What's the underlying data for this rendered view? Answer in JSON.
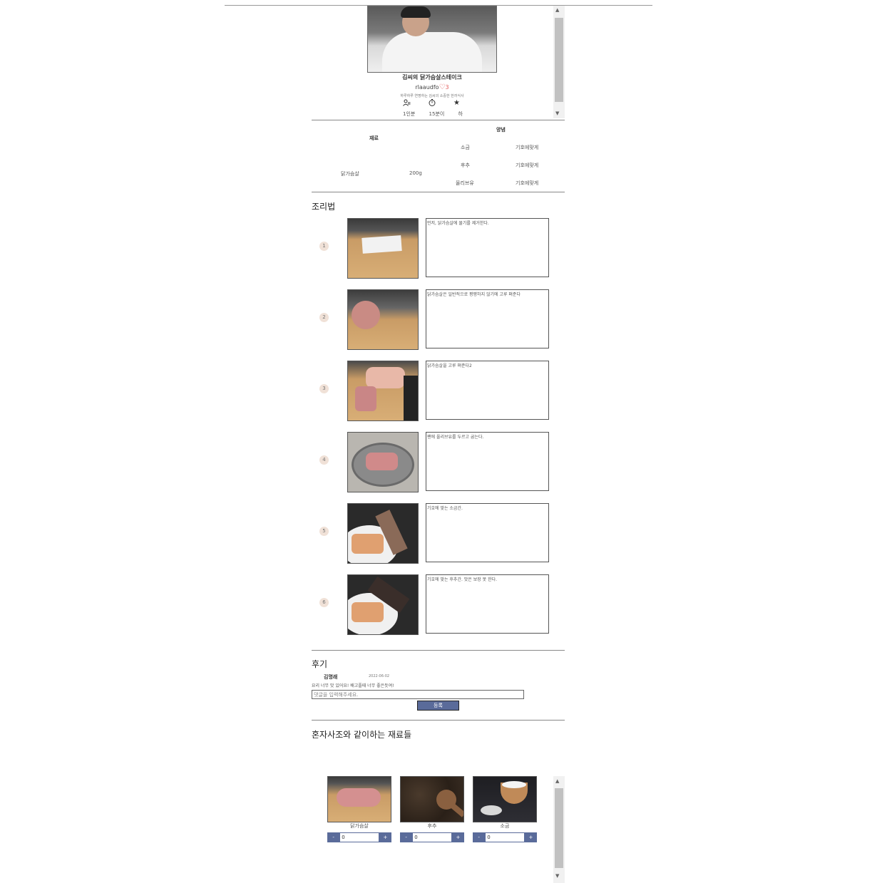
{
  "recipe": {
    "title": "김씨의 닭가슴살스테이크",
    "author": "rlaaudfo",
    "heart_icon": "♡",
    "likes": "3",
    "subtitle": "하루하루 연명하는 김씨의 소중한 한끼식사",
    "icons": {
      "servings": "servings-icon",
      "time": "timer-icon",
      "difficulty": "star-icon"
    },
    "servings": "1인분",
    "time": "15분이",
    "difficulty": "하"
  },
  "ingredients": {
    "header": "재료",
    "items": [
      {
        "name": "닭가슴살",
        "amount": "200g"
      }
    ]
  },
  "seasoning": {
    "header": "양념",
    "items": [
      {
        "name": "소금",
        "amount": "기호에맞게"
      },
      {
        "name": "후추",
        "amount": "기호에맞게"
      },
      {
        "name": "올리브유",
        "amount": "기호에맞게"
      }
    ]
  },
  "steps_title": "조리법",
  "steps": [
    {
      "num": "1",
      "text": "먼저, 닭가슴살에 물기를 제거한다."
    },
    {
      "num": "2",
      "text": "닭가슴살은 일반적으로 평평하지 않기에 고루 펴준다"
    },
    {
      "num": "3",
      "text": "닭가슴살을 고루 펴준다2"
    },
    {
      "num": "4",
      "text": "팬에 올리브유를 두르고 굽는다."
    },
    {
      "num": "5",
      "text": "기호에 맞는 소금간."
    },
    {
      "num": "6",
      "text": "기호에 맞는 후추간. 맛은 보장 못 한다."
    }
  ],
  "reviews_title": "후기",
  "review": {
    "name": "김명래",
    "date": "2022-06-02",
    "text": "요리 너무 맛 있어요! 배고플때 너무 좋은듯여!"
  },
  "comment": {
    "placeholder": "댓글을 입력해주세요.",
    "submit": "등록"
  },
  "products_title": "혼자사조와 같이하는 재료들",
  "products": [
    {
      "name": "닭가슴살",
      "qty": "0",
      "minus": "-",
      "plus": "+"
    },
    {
      "name": "후추",
      "qty": "0",
      "minus": "-",
      "plus": "+"
    },
    {
      "name": "소금",
      "qty": "0",
      "minus": "-",
      "plus": "+"
    }
  ]
}
